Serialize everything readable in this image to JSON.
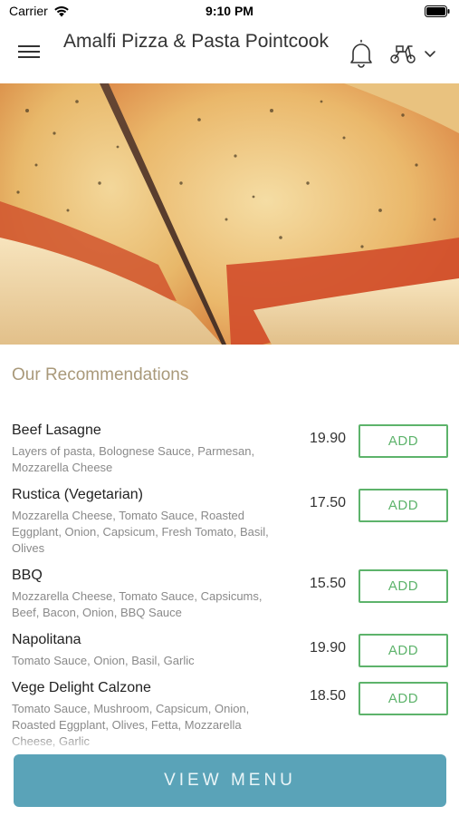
{
  "status_bar": {
    "carrier": "Carrier",
    "time": "9:10 PM"
  },
  "header": {
    "title": "Amalfi Pizza & Pasta Pointcook"
  },
  "section": {
    "title": "Our Recommendations"
  },
  "menu_items": [
    {
      "name": "Beef Lasagne",
      "description": "Layers of pasta, Bolognese Sauce, Parmesan, Mozzarella Cheese",
      "price": "19.90",
      "add_label": "ADD"
    },
    {
      "name": "Rustica (Vegetarian)",
      "description": "Mozzarella Cheese, Tomato Sauce, Roasted Eggplant, Onion, Capsicum, Fresh Tomato, Basil, Olives",
      "price": "17.50",
      "add_label": "ADD"
    },
    {
      "name": "BBQ",
      "description": "Mozzarella Cheese, Tomato Sauce, Capsicums, Beef, Bacon, Onion, BBQ Sauce",
      "price": "15.50",
      "add_label": "ADD"
    },
    {
      "name": "Napolitana",
      "description": "Tomato Sauce, Onion, Basil, Garlic",
      "price": "19.90",
      "add_label": "ADD"
    },
    {
      "name": "Vege Delight Calzone",
      "description": "Tomato Sauce, Mushroom, Capsicum, Onion, Roasted Eggplant, Olives, Fetta, Mozzarella Cheese, Garlic",
      "price": "18.50",
      "add_label": "ADD"
    }
  ],
  "footer": {
    "view_menu_label": "VIEW MENU"
  },
  "colors": {
    "accent_green": "#5db36b",
    "button_blue": "#5aa3b8",
    "section_title": "#a9997a"
  },
  "icons": {
    "menu": "hamburger-icon",
    "notifications": "bell-icon",
    "delivery": "scooter-icon",
    "dropdown": "chevron-down-icon",
    "wifi": "wifi-icon",
    "battery": "battery-icon"
  }
}
